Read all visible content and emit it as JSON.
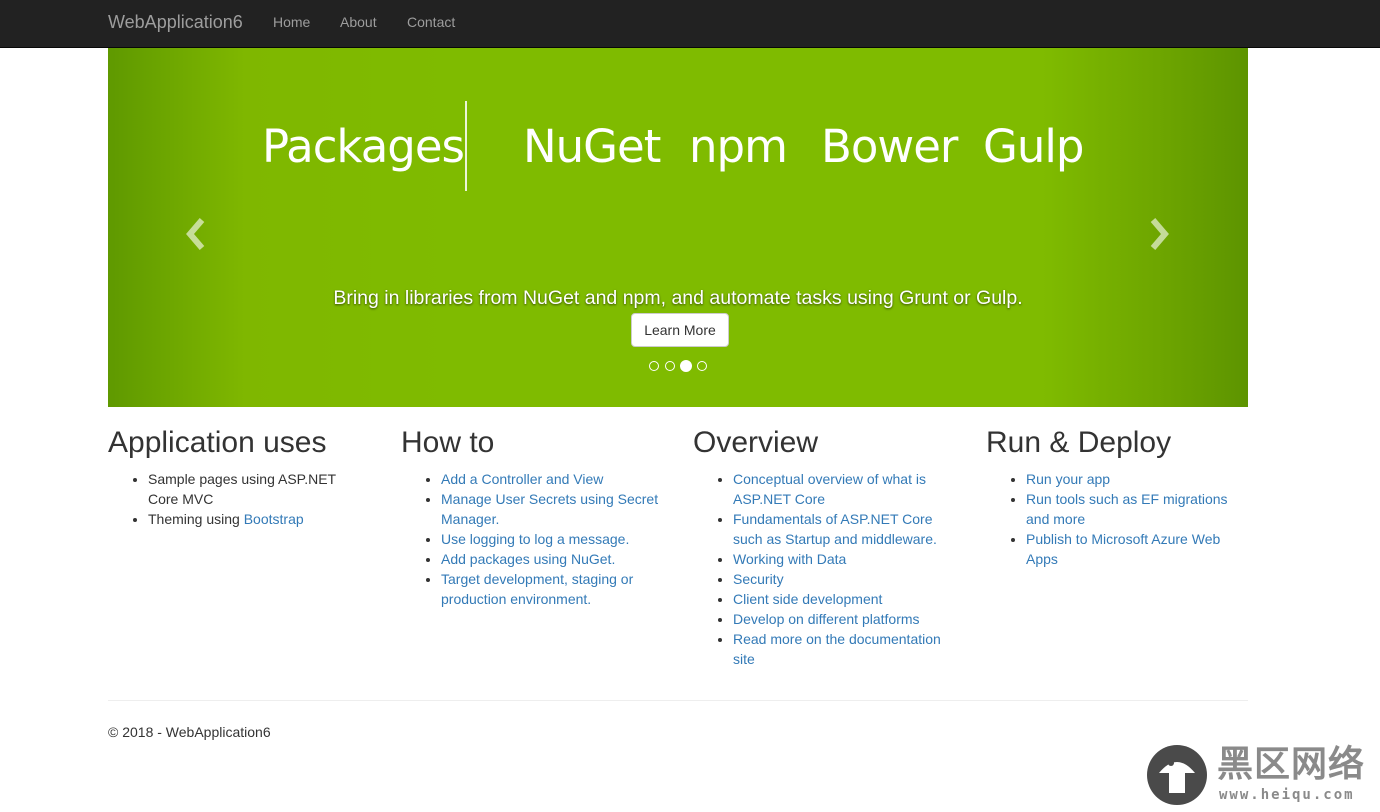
{
  "navbar": {
    "brand": "WebApplication6",
    "links": [
      "Home",
      "About",
      "Contact"
    ]
  },
  "carousel": {
    "heading": "Packages",
    "items": [
      "NuGet",
      "npm",
      "Bower",
      "Gulp"
    ],
    "caption": "Bring in libraries from NuGet and npm, and automate tasks using Grunt or Gulp.",
    "button_label": "Learn More",
    "prev_icon": "chevron-left-icon",
    "next_icon": "chevron-right-icon",
    "indicator_count": 4,
    "active_indicator": 3,
    "background_color": "#7fbb00"
  },
  "columns": [
    {
      "title": "Application uses",
      "items": [
        {
          "text": "Sample pages using ASP.NET Core MVC"
        },
        {
          "prefix": "Theming using ",
          "link": "Bootstrap"
        }
      ]
    },
    {
      "title": "How to",
      "links": [
        "Add a Controller and View",
        "Manage User Secrets using Secret Manager.",
        "Use logging to log a message.",
        "Add packages using NuGet.",
        "Target development, staging or production environment."
      ]
    },
    {
      "title": "Overview",
      "links": [
        "Conceptual overview of what is ASP.NET Core",
        "Fundamentals of ASP.NET Core such as Startup and middleware.",
        "Working with Data",
        "Security",
        "Client side development",
        "Develop on different platforms",
        "Read more on the documentation site"
      ]
    },
    {
      "title": "Run & Deploy",
      "links": [
        "Run your app",
        "Run tools such as EF migrations and more",
        "Publish to Microsoft Azure Web Apps"
      ]
    }
  ],
  "footer": {
    "text": "© 2018 - WebApplication6"
  },
  "watermark": {
    "name": "黑区网络",
    "url": "www.heiqu.com"
  },
  "colors": {
    "navbar_bg": "#222222",
    "link": "#337ab7",
    "carousel_green": "#7fbb00"
  }
}
